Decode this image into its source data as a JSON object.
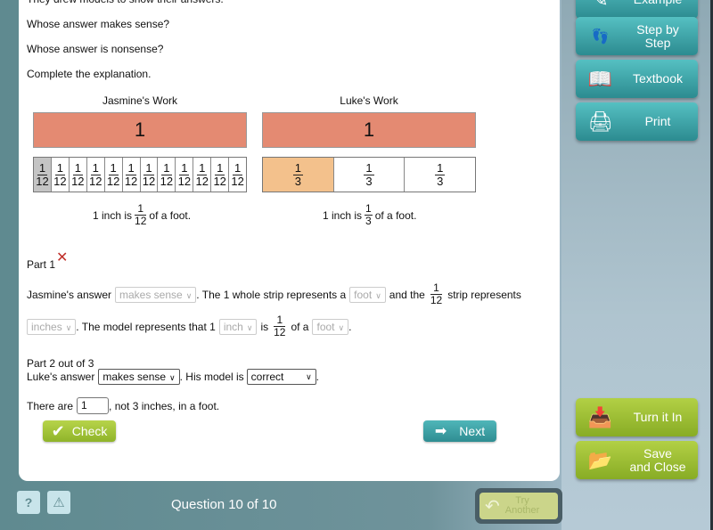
{
  "question": {
    "intro_partial": "They drew models to show their answers.",
    "prompts": [
      "Whose answer makes sense?",
      "Whose answer is nonsense?",
      "Complete the explanation."
    ]
  },
  "models": {
    "jasmine": {
      "title": "Jasmine's Work",
      "whole_label": "1",
      "parts": [
        "1/12",
        "1/12",
        "1/12",
        "1/12",
        "1/12",
        "1/12",
        "1/12",
        "1/12",
        "1/12",
        "1/12",
        "1/12",
        "1/12"
      ],
      "part_num": "1",
      "part_den": "12",
      "shaded_index": 0,
      "caption_pre": "1 inch is",
      "caption_num": "1",
      "caption_den": "12",
      "caption_post": "of a foot."
    },
    "luke": {
      "title": "Luke's Work",
      "whole_label": "1",
      "part_num": "1",
      "part_den": "3",
      "shaded_index": 0,
      "caption_pre": "1 inch is",
      "caption_num": "1",
      "caption_den": "3",
      "caption_post": "of a foot."
    }
  },
  "part1": {
    "label": "Part 1",
    "status": "incorrect",
    "line1": {
      "t1": "Jasmine's answer",
      "sel1": "makes sense",
      "t2": ". The 1 whole strip represents a",
      "sel2": "foot",
      "t3": "and the",
      "frac_num": "1",
      "frac_den": "12",
      "t4": "strip represents"
    },
    "line2": {
      "sel1": "inches",
      "t1": ". The model represents that 1",
      "sel2": "inch",
      "t2": "is",
      "frac_num": "1",
      "frac_den": "12",
      "t3": "of a",
      "sel3": "foot",
      "t4": "."
    }
  },
  "part2": {
    "label": "Part 2 out of 3",
    "t1": "Luke's answer",
    "sel1": "makes sense",
    "t2": ". His model is",
    "sel2": "correct",
    "t3": ".",
    "line2_pre": "There are",
    "input_value": "1",
    "line2_post": ", not 3 inches, in a foot."
  },
  "buttons": {
    "check": "Check",
    "next": "Next"
  },
  "sidebar": {
    "items": [
      {
        "label": "Example",
        "icon": "example-icon"
      },
      {
        "label": "Step by Step",
        "icon": "footprints-icon"
      },
      {
        "label": "Textbook",
        "icon": "book-icon"
      },
      {
        "label": "Print",
        "icon": "printer-icon"
      }
    ],
    "turn_it_in": "Turn it In",
    "save_close_1": "Save",
    "save_close_2": "and Close"
  },
  "footer": {
    "help": "?",
    "alert": "!",
    "question_counter": "Question 10 of 10",
    "try_another_1": "Try",
    "try_another_2": "Another"
  }
}
